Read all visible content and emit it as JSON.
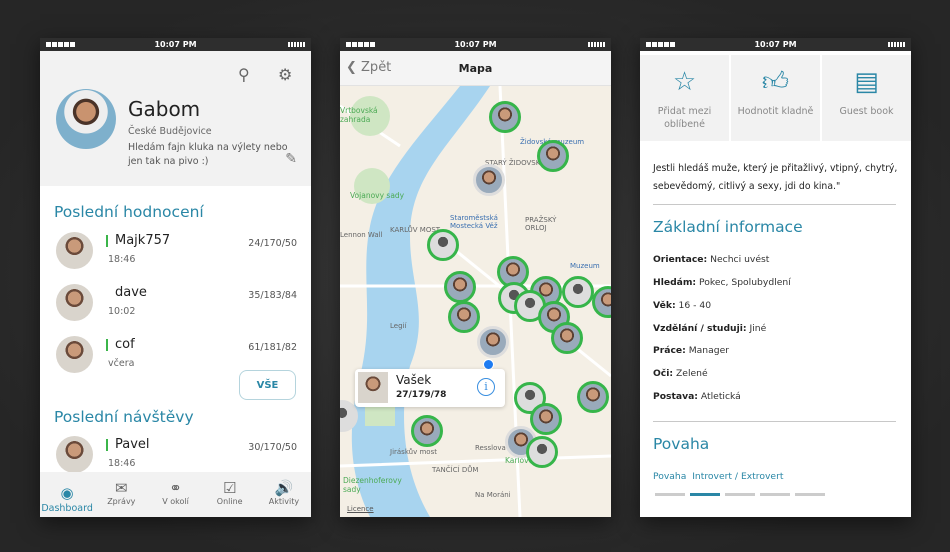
{
  "status_bar": {
    "time": "10:07 PM"
  },
  "dashboard": {
    "profile": {
      "name": "Gabom",
      "city": "České Budějovice",
      "description": "Hledám fajn kluka na výlety nebo jen tak na pivo :)"
    },
    "icons": {
      "search": "search-icon",
      "settings": "gear-icon",
      "edit": "edit-icon"
    },
    "ratings_title": "Poslední hodnocení",
    "ratings": [
      {
        "name": "Majk757",
        "time": "18:46",
        "stats": "24/170/50",
        "online": true
      },
      {
        "name": "dave",
        "time": "10:02",
        "stats": "35/183/84",
        "online": false
      },
      {
        "name": "cof",
        "time": "včera",
        "stats": "61/181/82",
        "online": true
      }
    ],
    "all_button": "VŠE",
    "visits_title": "Poslední návštěvy",
    "visits": [
      {
        "name": "Pavel",
        "time": "18:46",
        "stats": "30/170/50",
        "online": true
      }
    ],
    "tabs": [
      {
        "label": "Dashboard",
        "icon": "user-circle-icon",
        "active": true
      },
      {
        "label": "Zprávy",
        "icon": "envelope-icon"
      },
      {
        "label": "V okolí",
        "icon": "gauge-icon"
      },
      {
        "label": "Online",
        "icon": "phone-check-icon"
      },
      {
        "label": "Aktivity",
        "icon": "speaker-icon"
      }
    ]
  },
  "map_screen": {
    "back": "Zpět",
    "title": "Mapa",
    "labels": [
      "Vojanovy sady",
      "Židovské muzeum",
      "STARÝ ŽIDOVSKÝ",
      "Staroměstská Mostecká Věž",
      "KARLŮV MOST",
      "PRAŽSKÝ ORLOJ",
      "Legií",
      "Jiráskův most",
      "Resslova",
      "TANČÍCÍ DŮM",
      "Diezenhoferovy sady",
      "Na Moráni",
      "Karlovo",
      "Muzeum",
      "Lennon Wall",
      "Vrtbovská zahrada"
    ],
    "popup": {
      "name": "Vašek",
      "stats": "27/179/78"
    },
    "licence": "Licence"
  },
  "profile_screen": {
    "actions": [
      {
        "label": "Přidat mezi oblíbené",
        "icon": "star-icon"
      },
      {
        "label": "Hodnotit kladně",
        "icon": "thumbs-up-icon"
      },
      {
        "label": "Guest book",
        "icon": "notebook-icon"
      }
    ],
    "quote": "Jestli hledáš muže, který je přitažlivý, vtipný, chytrý, sebevědomý, citlivý a sexy, jdi do kina.\"",
    "basic_title": "Základní informace",
    "info": [
      {
        "key": "Orientace:",
        "value": "Nechci uvést"
      },
      {
        "key": "Hledám:",
        "value": "Pokec, Spolubydlení"
      },
      {
        "key": "Věk:",
        "value": "16 - 40"
      },
      {
        "key": "Vzdělání / studuji:",
        "value": "Jiné"
      },
      {
        "key": "Práce:",
        "value": "Manager"
      },
      {
        "key": "Oči:",
        "value": "Zelené"
      },
      {
        "key": "Postava:",
        "value": " Atletická"
      }
    ],
    "trait_title": "Povaha",
    "trait": {
      "label": "Povaha",
      "value": "Introvert / Extrovert",
      "level": 2,
      "steps": 5
    }
  },
  "colors": {
    "accent": "#2a87a6",
    "online": "#3bb54a",
    "map_marker": "#36b54a"
  }
}
